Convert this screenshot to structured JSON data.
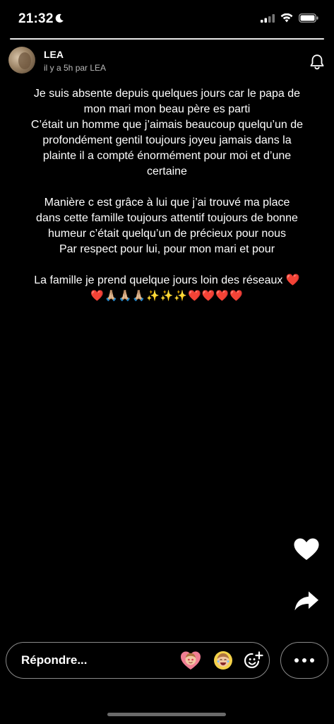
{
  "status": {
    "time": "21:32",
    "icons": [
      "moon-icon",
      "signal-icon",
      "wifi-icon",
      "battery-icon"
    ]
  },
  "story": {
    "progress": 1.0,
    "author": "LEA",
    "meta": "il y a 5h par LEA",
    "header_icons": [
      "avatar",
      "bell-icon"
    ]
  },
  "text": {
    "paragraph1": "Je suis absente depuis quelques jours car le papa de mon mari mon beau père es parti\nC’était un homme que j’aimais beaucoup quelqu’un de profondément gentil toujours joyeu jamais dans la plainte il a compté énormément pour moi et d’une certaine",
    "paragraph2": "Manière c est grâce à lui que j’ai trouvé ma place dans cette famille toujours attentif toujours de bonne humeur c’était quelqu’un de précieux pour nous\nPar respect pour lui, pour mon mari et pour",
    "paragraph3": "La famille je prend quelque jours loin des réseaux ❤️",
    "emoji_line": "❤️🙏🏼🙏🏼🙏🏼✨✨✨❤️❤️❤️❤️"
  },
  "actions": {
    "like_icon": "heart-icon",
    "share_icon": "share-arrow-icon",
    "reply_placeholder": "Répondre...",
    "reaction_icons": [
      "heart-eyes-bitmoji-icon",
      "laughing-bitmoji-icon",
      "sticker-icon"
    ],
    "more_icon": "more-icon"
  },
  "colors": {
    "background": "#000000",
    "text": "#ffffff",
    "muted": "#b9b9b9",
    "border": "#8a8a8a"
  }
}
